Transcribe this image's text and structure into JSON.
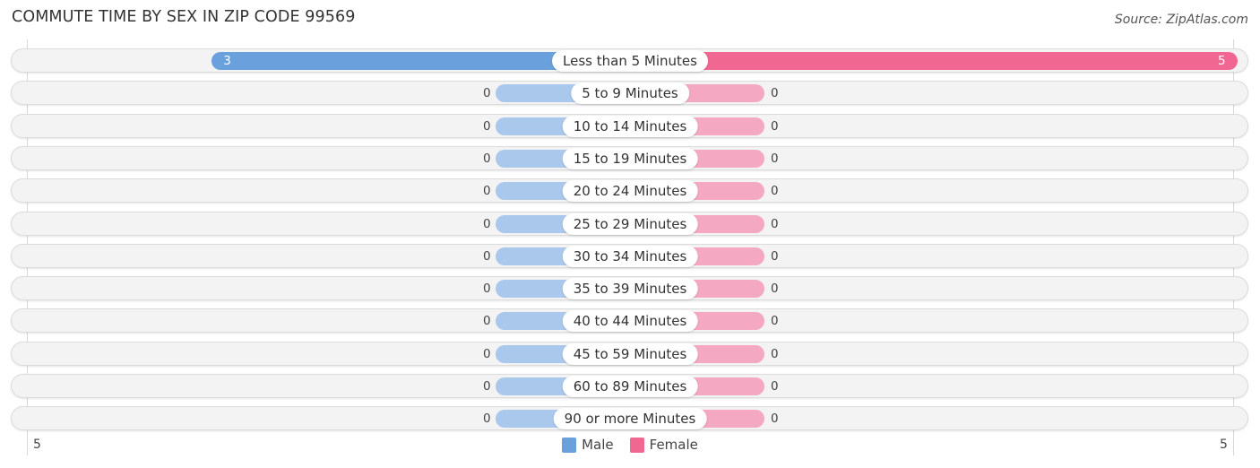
{
  "title": "COMMUTE TIME BY SEX IN ZIP CODE 99569",
  "source": "Source: ZipAtlas.com",
  "colors": {
    "male": "#6aa0dc",
    "male_light": "#a9c8ec",
    "female": "#f06792",
    "female_light": "#f5a8c2"
  },
  "chart_data": {
    "type": "bar",
    "orientation": "horizontal-diverging",
    "title": "COMMUTE TIME BY SEX IN ZIP CODE 99569",
    "categories": [
      "Less than 5 Minutes",
      "5 to 9 Minutes",
      "10 to 14 Minutes",
      "15 to 19 Minutes",
      "20 to 24 Minutes",
      "25 to 29 Minutes",
      "30 to 34 Minutes",
      "35 to 39 Minutes",
      "40 to 44 Minutes",
      "45 to 59 Minutes",
      "60 to 89 Minutes",
      "90 or more Minutes"
    ],
    "series": [
      {
        "name": "Male",
        "values": [
          3,
          0,
          0,
          0,
          0,
          0,
          0,
          0,
          0,
          0,
          0,
          0
        ]
      },
      {
        "name": "Female",
        "values": [
          5,
          0,
          0,
          0,
          0,
          0,
          0,
          0,
          0,
          0,
          0,
          0
        ]
      }
    ],
    "axis": {
      "left_tick": "5",
      "right_tick": "5",
      "max": 5
    },
    "legend": {
      "position": "bottom-center",
      "entries": [
        "Male",
        "Female"
      ]
    }
  }
}
